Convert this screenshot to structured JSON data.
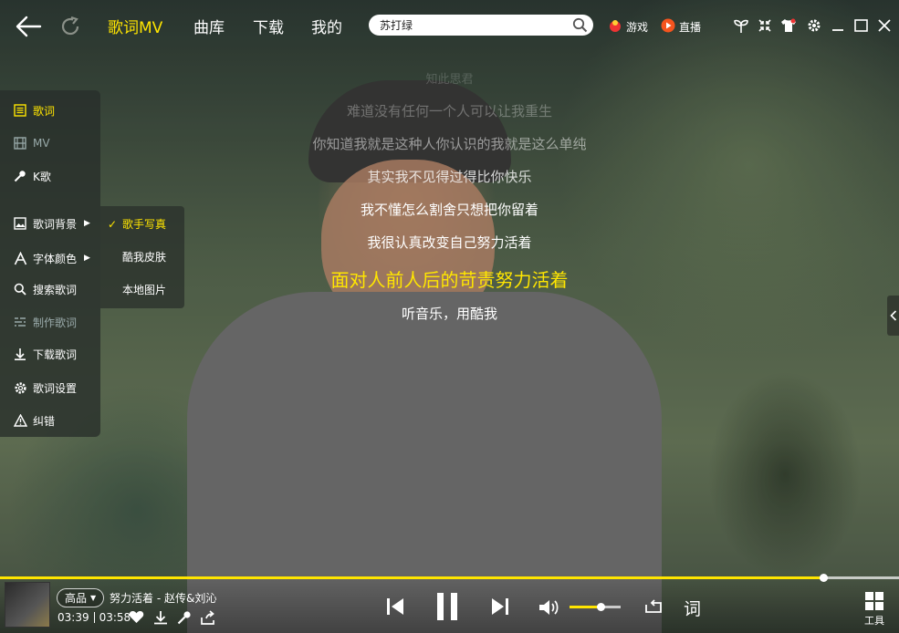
{
  "nav": {
    "tabs": [
      {
        "label": "歌词MV",
        "active": true
      },
      {
        "label": "曲库",
        "active": false
      },
      {
        "label": "下载",
        "active": false
      },
      {
        "label": "我的",
        "active": false
      }
    ],
    "search_value": "苏打绿",
    "game_label": "游戏",
    "live_label": "直播"
  },
  "sidebar": {
    "items": [
      {
        "label": "歌词",
        "icon": "lyrics-icon",
        "active": true
      },
      {
        "label": "MV",
        "icon": "film-icon",
        "dim": true
      },
      {
        "label": "K歌",
        "icon": "microphone-icon"
      },
      {
        "label": "歌词背景",
        "icon": "image-icon",
        "submenu": true
      },
      {
        "label": "字体颜色",
        "icon": "font-icon",
        "submenu": true
      },
      {
        "label": "搜索歌词",
        "icon": "search-icon"
      },
      {
        "label": "制作歌词",
        "icon": "edit-lyrics-icon",
        "dim": true
      },
      {
        "label": "下载歌词",
        "icon": "download-icon"
      },
      {
        "label": "歌词设置",
        "icon": "gear-icon"
      },
      {
        "label": "纠错",
        "icon": "warning-icon"
      }
    ],
    "background_submenu": [
      {
        "label": "歌手写真",
        "selected": true
      },
      {
        "label": "酷我皮肤",
        "selected": false
      },
      {
        "label": "本地图片",
        "selected": false
      }
    ]
  },
  "lyrics": {
    "faded_top": "知此思君",
    "line1": "难道没有任何一个人可以让我重生",
    "line2": "你知道我就是这种人你认识的我就是这么单纯",
    "line3": "其实我不见得过得比你快乐",
    "line4": "我不懂怎么割舍只想把你留着",
    "line5": "我很认真改变自己努力活着",
    "current": "面对人前人后的苛责努力活着",
    "next": "听音乐，用酷我"
  },
  "player": {
    "quality": "高品",
    "song": "努力活着 - 赵传&刘沁",
    "elapsed": "03:39",
    "duration": "03:58",
    "progress": 0.916,
    "volume": 0.6,
    "lyrics_button": "词",
    "tools_label": "工具"
  },
  "colors": {
    "accent": "#ffe500",
    "current_lyric": "#ffe600"
  }
}
